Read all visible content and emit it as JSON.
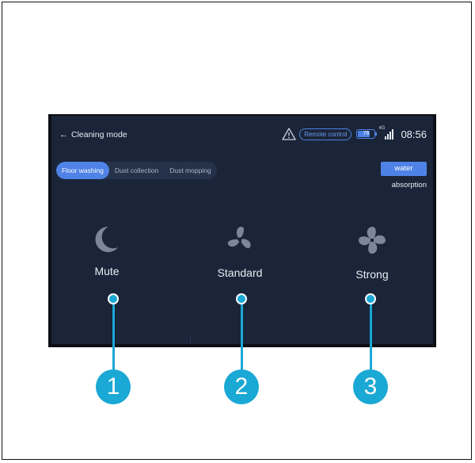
{
  "header": {
    "back_label": "Cleaning mode",
    "remote_label": "Remote control",
    "battery_percent": 76,
    "battery_text": "76",
    "network_label": "4G",
    "time": "08:56"
  },
  "tabs": [
    {
      "label": "Floor washing",
      "active": true
    },
    {
      "label": "Dust collection",
      "active": false
    },
    {
      "label": "Dust mopping",
      "active": false
    }
  ],
  "water": {
    "button_label": "water",
    "sub_label": "absorption"
  },
  "modes": [
    {
      "label": "Mute",
      "icon": "moon-icon",
      "callout": "1"
    },
    {
      "label": "Standard",
      "icon": "fan-icon",
      "callout": "2"
    },
    {
      "label": "Strong",
      "icon": "fan-icon",
      "callout": "3"
    }
  ],
  "colors": {
    "panel_bg": "#1a2539",
    "accent": "#4e82e6",
    "callout": "#1aa8d4",
    "icon": "#7c8799"
  }
}
